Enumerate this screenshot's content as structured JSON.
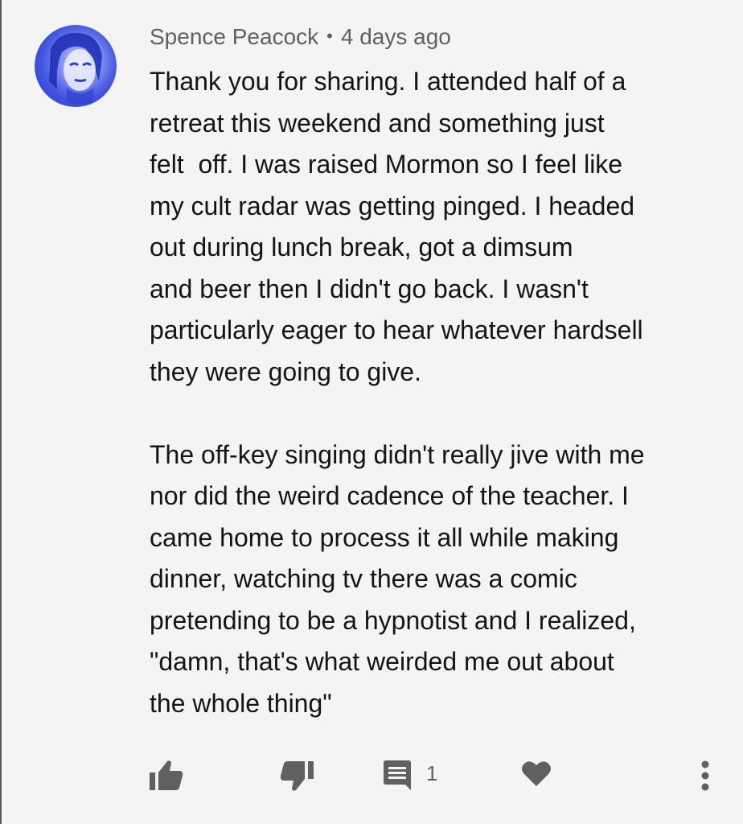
{
  "comment": {
    "author": "Spence Peacock",
    "separator": "•",
    "timestamp": "4 days ago",
    "paragraph1": [
      "Thank you for sharing. I attended half of a",
      "retreat this weekend and something just",
      "felt  off. I was raised Mormon so I feel like",
      "my cult radar was getting pinged. I headed",
      "out during lunch break, got a dimsum",
      "and beer then I didn't go back. I wasn't",
      "particularly eager to hear whatever hardsell",
      "they were going to give."
    ],
    "paragraph2": [
      "The off-key singing didn't really jive with me",
      "nor did the weird cadence of the teacher. I",
      "came home to process it all while making",
      "dinner, watching tv there was a comic",
      "pretending to be a hypnotist and I realized,",
      "\"damn, that's what weirded me out about",
      "the whole thing\""
    ],
    "reply_count": "1"
  },
  "icons": {
    "like": "thumbs-up-icon",
    "dislike": "thumbs-down-icon",
    "reply": "comment-icon",
    "heart": "heart-icon",
    "more": "more-vertical-icon"
  },
  "colors": {
    "background": "#f4f4f4",
    "text": "#141414",
    "meta_text": "#606060",
    "icon": "#606060",
    "avatar_blue": "#2b3fd6"
  }
}
